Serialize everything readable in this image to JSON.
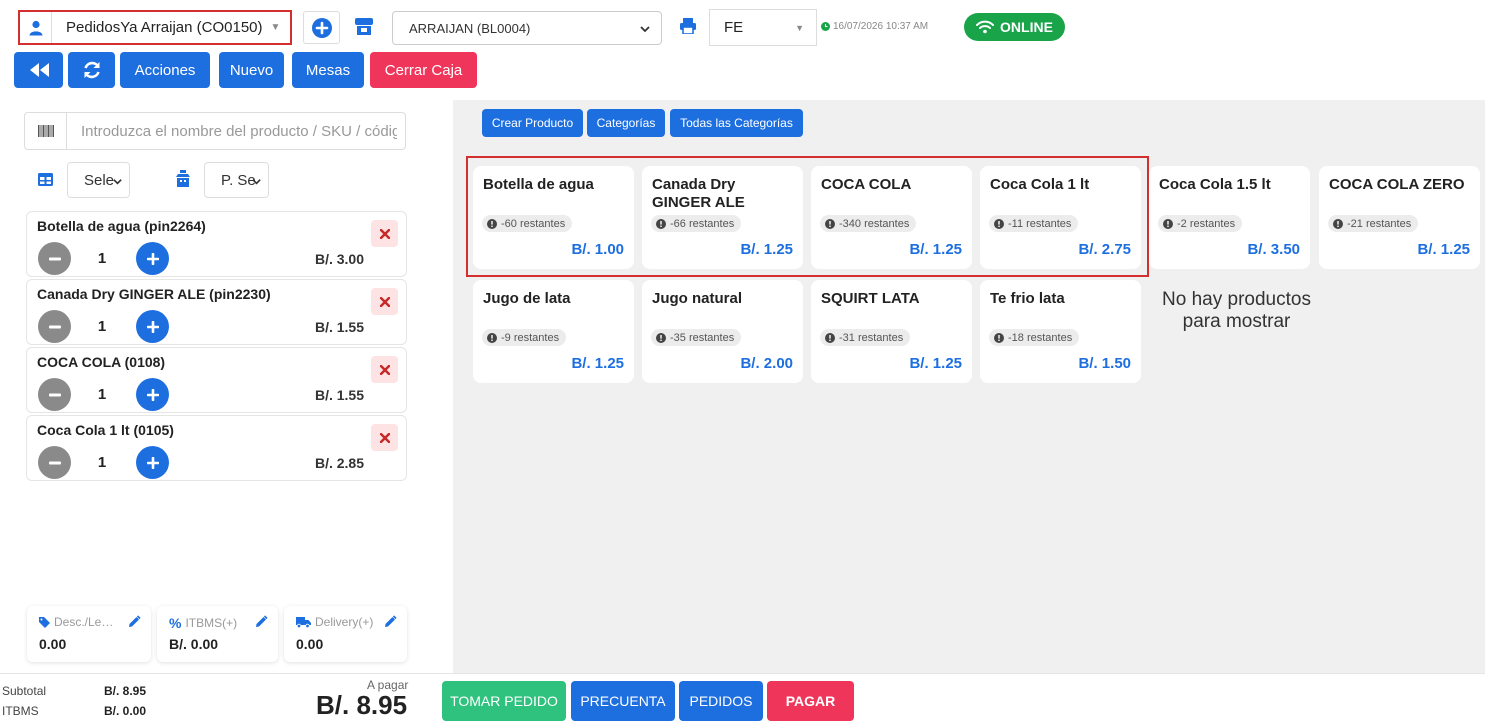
{
  "header": {
    "customer": "PedidosYa Arraijan (CO0150)",
    "store": "ARRAIJAN (BL0004)",
    "doc_type": "FE",
    "datetime": "16/07/2026 10:37 AM",
    "status": "ONLINE",
    "status_color": "#1aa44a"
  },
  "toolbar": {
    "acciones": "Acciones",
    "nuevo": "Nuevo",
    "mesas": "Mesas",
    "cerrar_caja": "Cerrar Caja"
  },
  "search": {
    "placeholder": "Introduzca el nombre del producto / SKU / código"
  },
  "filters": {
    "select1": "Sele",
    "select2": "P. Se"
  },
  "cart": [
    {
      "title": "Botella de agua (pin2264)",
      "qty": "1",
      "price": "B/. 3.00"
    },
    {
      "title": "Canada Dry GINGER ALE (pin2230)",
      "qty": "1",
      "price": "B/. 1.55"
    },
    {
      "title": "COCA COLA (0108)",
      "qty": "1",
      "price": "B/. 1.55"
    },
    {
      "title": "Coca Cola 1 lt (0105)",
      "qty": "1",
      "price": "B/. 2.85"
    }
  ],
  "adjustments": {
    "discount_label": "Desc./Le…",
    "discount_value": "0.00",
    "tax_label": "ITBMS(+)",
    "tax_value": "B/. 0.00",
    "delivery_label": "Delivery(+)",
    "delivery_value": "0.00"
  },
  "category_buttons": {
    "create": "Crear Producto",
    "categories": "Categorías",
    "all": "Todas las Categorías"
  },
  "products": [
    {
      "name": "Botella de agua",
      "stock": "-60 restantes",
      "price": "B/. 1.00"
    },
    {
      "name": "Canada Dry GINGER ALE",
      "stock": "-66 restantes",
      "price": "B/. 1.25"
    },
    {
      "name": "COCA COLA",
      "stock": "-340 restantes",
      "price": "B/. 1.25"
    },
    {
      "name": "Coca Cola 1 lt",
      "stock": "-11 restantes",
      "price": "B/. 2.75"
    },
    {
      "name": "Coca Cola 1.5 lt",
      "stock": "-2 restantes",
      "price": "B/. 3.50"
    },
    {
      "name": "COCA COLA ZERO",
      "stock": "-21 restantes",
      "price": "B/. 1.25"
    },
    {
      "name": "Jugo de lata",
      "stock": "-9 restantes",
      "price": "B/. 1.25"
    },
    {
      "name": "Jugo natural",
      "stock": "-35 restantes",
      "price": "B/. 2.00"
    },
    {
      "name": "SQUIRT LATA",
      "stock": "-31 restantes",
      "price": "B/. 1.25"
    },
    {
      "name": "Te frio lata",
      "stock": "-18 restantes",
      "price": "B/. 1.50"
    }
  ],
  "empty_message": "No hay productos para mostrar",
  "footer": {
    "subtotal_label": "Subtotal",
    "subtotal_value": "B/. 8.95",
    "itbms_label": "ITBMS",
    "itbms_value": "B/. 0.00",
    "to_pay_label": "A pagar",
    "total": "B/. 8.95",
    "tomar_pedido": "TOMAR PEDIDO",
    "precuenta": "PRECUENTA",
    "pedidos": "PEDIDOS",
    "pagar": "PAGAR"
  },
  "colors": {
    "primary": "#1d6fe0",
    "danger": "#f0355b",
    "success": "#2ec27e",
    "price_blue": "#1d6fe0"
  }
}
